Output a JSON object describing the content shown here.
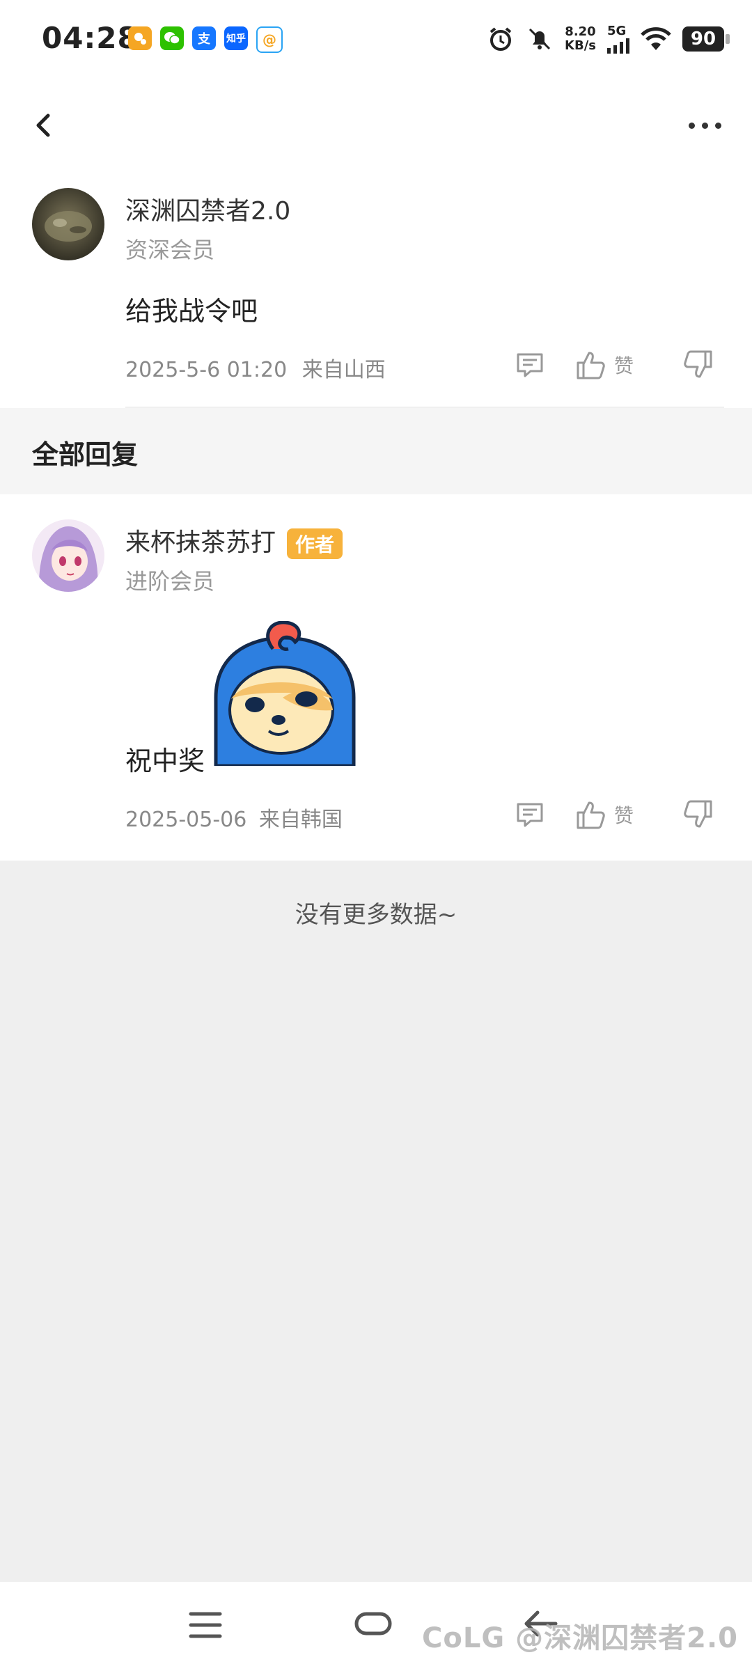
{
  "status_bar": {
    "time": "04:28",
    "net_speed_value": "8.20",
    "net_speed_unit": "KB/s",
    "network_type": "5G",
    "battery": "90",
    "app_icons": [
      {
        "name": "maps-icon",
        "label": "",
        "color": "#f5a623"
      },
      {
        "name": "wechat-icon",
        "label": "",
        "color": "#2dc100"
      },
      {
        "name": "alipay-icon",
        "label": "支",
        "color": "#1677ff"
      },
      {
        "name": "zhihu-icon",
        "label": "知乎",
        "color": "#0a66ff"
      },
      {
        "name": "qq-browser-icon",
        "label": "@",
        "color": "#ffffff"
      }
    ]
  },
  "header": {
    "back_icon": "chevron-left-icon",
    "more_icon": "more-horizontal-icon"
  },
  "main_comment": {
    "username": "深渊囚禁者2.0",
    "member_level": "资深会员",
    "content": "给我战令吧",
    "timestamp": "2025-5-6 01:20",
    "location": "来自山西",
    "like_label": "赞"
  },
  "replies_section": {
    "title": "全部回复"
  },
  "replies": [
    {
      "username": "来杯抹茶苏打",
      "badge": "作者",
      "member_level": "进阶会员",
      "content": "祝中奖",
      "timestamp": "2025-05-06",
      "location": "来自韩国",
      "like_label": "赞"
    }
  ],
  "footer": {
    "no_more": "没有更多数据~"
  },
  "watermark": "CoLG @深渊囚禁者2.0",
  "colors": {
    "accent_badge": "#f7b23b",
    "page_bg": "#efefef",
    "card_bg": "#ffffff"
  }
}
